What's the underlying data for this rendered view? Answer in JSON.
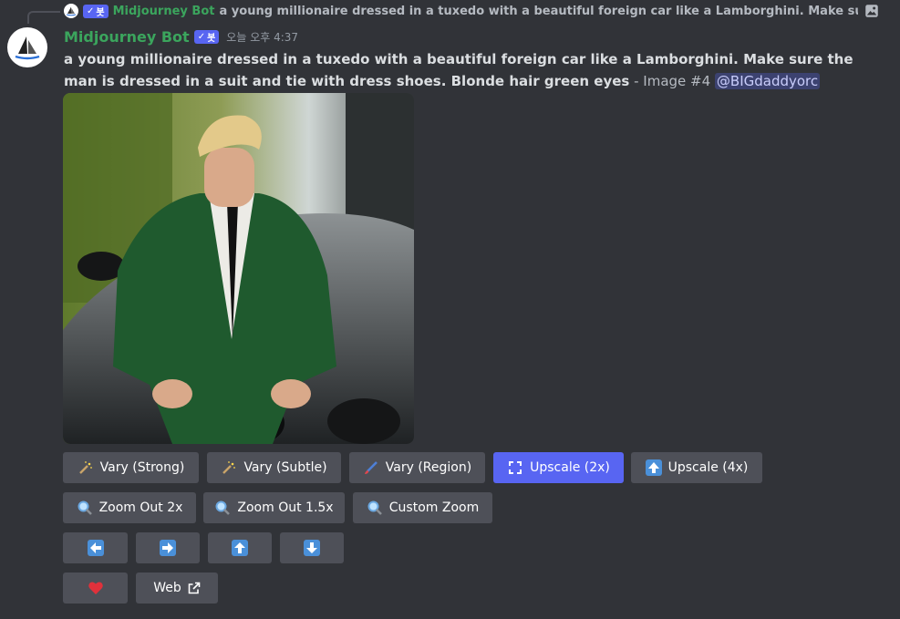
{
  "reply": {
    "author": "Midjourney Bot",
    "bot_tag": "봇",
    "text": "a young millionaire dressed in a tuxedo with a beautiful foreign car like a Lamborghini. Make sure the man is dressed in a suit and tie with dress shoes. Blonde hair green eyes",
    "attachment_icon": "image-icon"
  },
  "message": {
    "author": "Midjourney Bot",
    "bot_tag": "봇",
    "timestamp": "오늘 오후 4:37",
    "prompt": "a young millionaire dressed in a tuxedo with a beautiful foreign car like a Lamborghini. Make sure the man is dressed in a suit and tie with dress shoes. Blonde hair green eyes",
    "suffix": " - Image #4 ",
    "mention": "@BIGdaddyorc"
  },
  "colors": {
    "background": "#313338",
    "button": "#4e5058",
    "primary": "#5865f2",
    "author": "#3ba55d",
    "mention_bg": "#3c4270"
  },
  "buttons": {
    "vary_strong": {
      "label": "Vary (Strong)",
      "icon": "magic-wand-icon"
    },
    "vary_subtle": {
      "label": "Vary (Subtle)",
      "icon": "magic-wand-icon"
    },
    "vary_region": {
      "label": "Vary (Region)",
      "icon": "paintbrush-icon"
    },
    "upscale_2x": {
      "label": "Upscale (2x)",
      "icon": "expand-arrows-icon"
    },
    "upscale_4x": {
      "label": "Upscale (4x)",
      "icon": "up-arrow-icon"
    },
    "zoom_out_2x": {
      "label": "Zoom Out 2x",
      "icon": "magnifier-icon"
    },
    "zoom_out_1_5x": {
      "label": "Zoom Out 1.5x",
      "icon": "magnifier-icon"
    },
    "custom_zoom": {
      "label": "Custom Zoom",
      "icon": "magnifier-icon"
    },
    "pan_left": {
      "icon": "arrow-left-icon"
    },
    "pan_right": {
      "icon": "arrow-right-icon"
    },
    "pan_up": {
      "icon": "arrow-up-icon"
    },
    "pan_down": {
      "icon": "arrow-down-icon"
    },
    "favorite": {
      "icon": "heart-icon"
    },
    "web": {
      "label": "Web",
      "icon": "external-link-icon"
    }
  }
}
